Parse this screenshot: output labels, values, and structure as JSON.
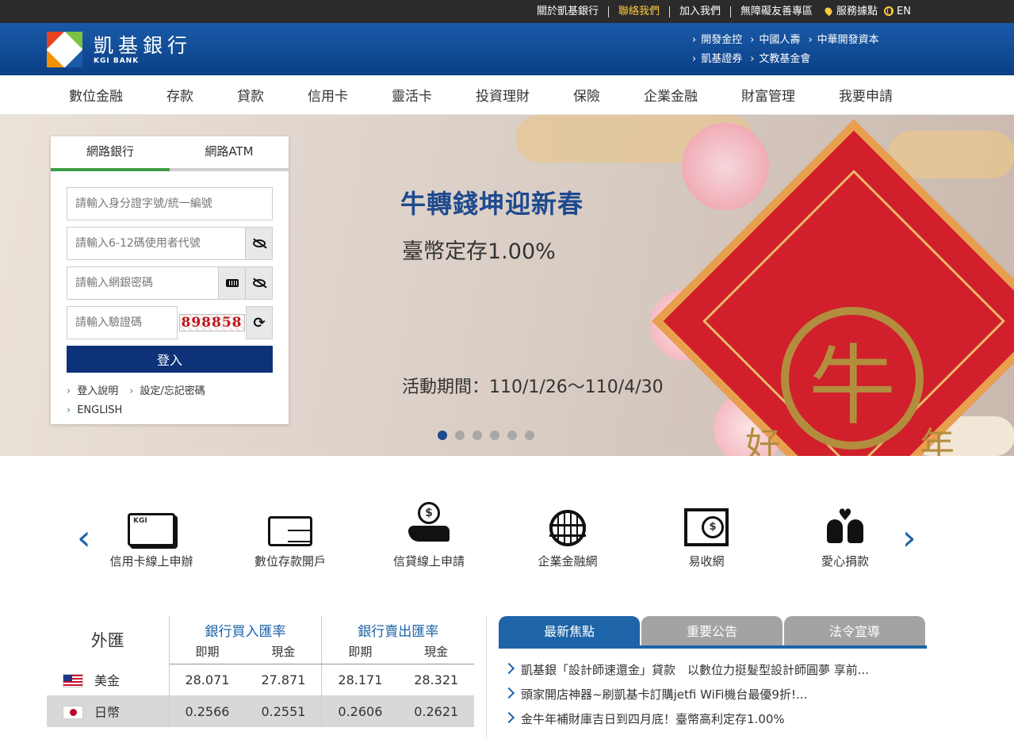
{
  "topbar": {
    "about": "關於凱基銀行",
    "contact": "聯絡我們",
    "join": "加入我們",
    "accessibility": "無障礙友善專區",
    "locations": "服務據點",
    "lang": "EN",
    "highlight_color": "#ffc93c"
  },
  "brand": {
    "name_zh": "凱基銀行",
    "name_en": "KGI BANK",
    "links": [
      "開發金控",
      "中國人壽",
      "中華開發資本",
      "凱基證券",
      "文教基金會"
    ]
  },
  "nav": [
    "數位金融",
    "存款",
    "貸款",
    "信用卡",
    "靈活卡",
    "投資理財",
    "保險",
    "企業金融",
    "財富管理",
    "我要申請"
  ],
  "login": {
    "tabs": [
      "網路銀行",
      "網路ATM"
    ],
    "id_placeholder": "請輸入身分證字號/統一編號",
    "user_placeholder": "請輸入6-12碼使用者代號",
    "password_placeholder": "請輸入網銀密碼",
    "captcha_placeholder": "請輸入驗證碼",
    "captcha_code": "898858",
    "submit": "登入",
    "links": [
      "登入說明",
      "設定/忘記密碼",
      "ENGLISH"
    ]
  },
  "banner": {
    "title": "牛轉錢坤迎新春",
    "subtitle": "臺幣定存1.00%",
    "period": "活動期間：110/1/26～110/4/30",
    "art_ox": "牛",
    "art_left": "好",
    "art_right": "年",
    "slide_count": 6,
    "active_slide": 1
  },
  "services": [
    {
      "label": "信用卡線上申辦",
      "icon": "credit-card-icon"
    },
    {
      "label": "數位存款開戶",
      "icon": "account-form-icon"
    },
    {
      "label": "信貸線上申請",
      "icon": "coin-hand-icon"
    },
    {
      "label": "企業金融網",
      "icon": "globe-icon"
    },
    {
      "label": "易收網",
      "icon": "payment-screen-icon"
    },
    {
      "label": "愛心捐款",
      "icon": "charity-heart-icon"
    }
  ],
  "fx": {
    "title": "外匯",
    "buy_header": "銀行買入匯率",
    "sell_header": "銀行賣出匯率",
    "spot": "即期",
    "cash": "現金",
    "rows": [
      {
        "currency": "美金",
        "buy_spot": "28.071",
        "buy_cash": "27.871",
        "sell_spot": "28.171",
        "sell_cash": "28.321"
      },
      {
        "currency": "日幣",
        "buy_spot": "0.2566",
        "buy_cash": "0.2551",
        "sell_spot": "0.2606",
        "sell_cash": "0.2621"
      }
    ]
  },
  "news": {
    "tabs": [
      "最新焦點",
      "重要公告",
      "法令宣導"
    ],
    "items": [
      "凱基銀「設計師速還金」貸款　以數位力挺髮型設計師圓夢 享前...",
      "頭家開店神器~刷凱基卡訂購jetfi WiFi機台最優9折!...",
      "金牛年補財庫吉日到四月底！臺幣高利定存1.00%"
    ]
  }
}
